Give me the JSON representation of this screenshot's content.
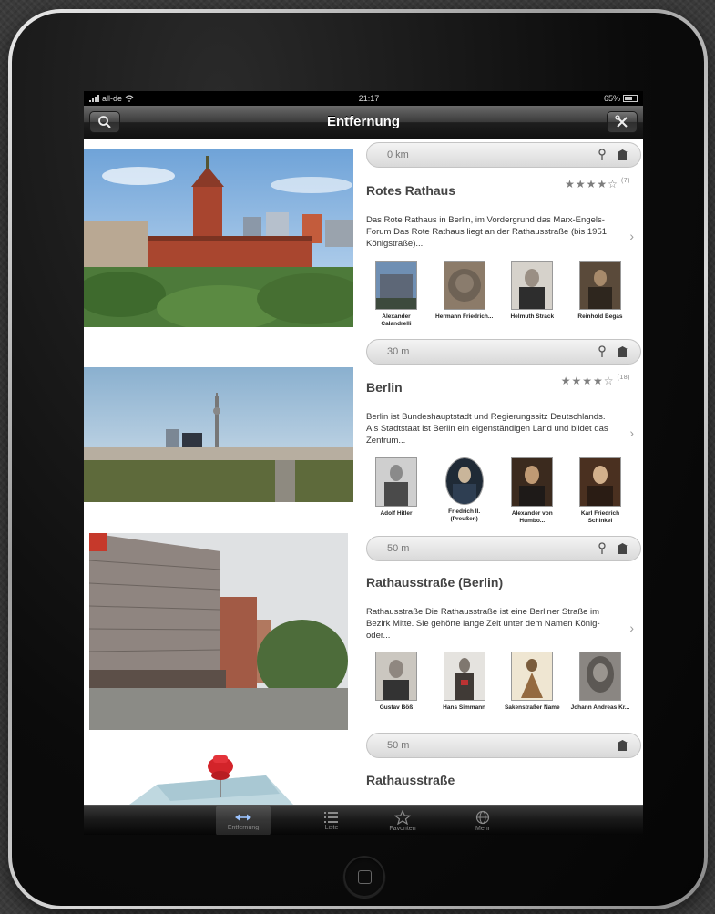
{
  "status": {
    "carrier": "all-de",
    "time": "21:17",
    "battery": "65%"
  },
  "nav": {
    "title": "Entfernung",
    "left_icon": "search-icon",
    "right_icon": "tools-icon"
  },
  "places": [
    {
      "distance": "0 km",
      "title": "Rotes Rathaus",
      "stars": "★★★★☆",
      "rating_count": "(7)",
      "description": "Das Rote Rathaus in Berlin, im Vordergrund das Marx-Engels-Forum Das Rote Rathaus liegt an der Rathausstraße (bis 1951 Königstraße)...",
      "people": [
        "Alexander Calandrelli",
        "Hermann Friedrich...",
        "Helmuth Strack",
        "Reinhold Begas"
      ]
    },
    {
      "distance": "30 m",
      "title": "Berlin",
      "stars": "★★★★☆",
      "rating_count": "(18)",
      "description": "Berlin ist Bundeshauptstadt und Regierungssitz Deutschlands. Als Stadtstaat ist Berlin ein eigenständigen Land und bildet das Zentrum...",
      "people": [
        "Adolf Hitler",
        "Friedrich II. (Preußen)",
        "Alexander von Humbo...",
        "Karl Friedrich Schinkel"
      ]
    },
    {
      "distance": "50 m",
      "title": "Rathausstraße (Berlin)",
      "description": "Rathausstraße Die Rathausstraße ist eine Berliner Straße im Bezirk Mitte. Sie gehörte lange Zeit unter dem Namen König- oder...",
      "people": [
        "Gustav Böß",
        "Hans Simmann",
        "Sakenstraßer Name",
        "Johann Andreas Kr..."
      ]
    },
    {
      "distance": "50 m",
      "title": "Rathausstraße"
    }
  ],
  "tabs": [
    {
      "label": "Entfernung",
      "icon": "arrows-icon"
    },
    {
      "label": "Liste",
      "icon": "list-icon"
    },
    {
      "label": "Favoriten",
      "icon": "star-icon"
    },
    {
      "label": "Mehr",
      "icon": "globe-icon"
    }
  ]
}
